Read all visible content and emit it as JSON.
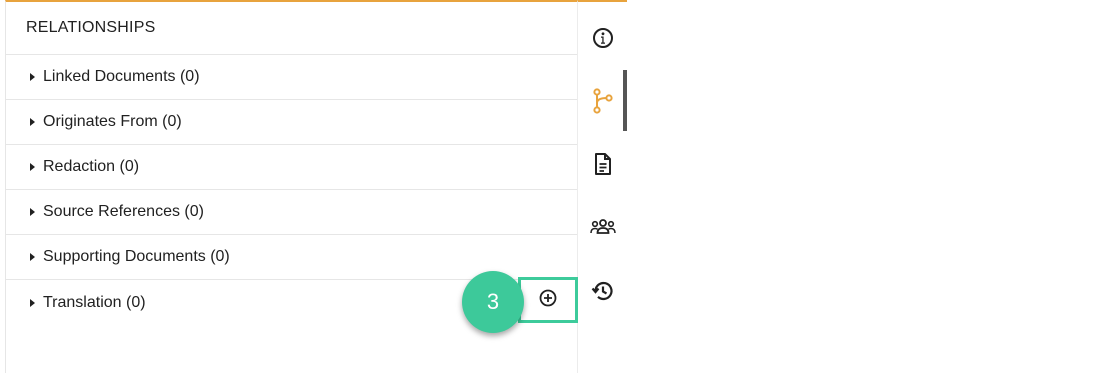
{
  "panel": {
    "title": "RELATIONSHIPS",
    "items": [
      {
        "label": "Linked Documents (0)"
      },
      {
        "label": "Originates From (0)"
      },
      {
        "label": "Redaction (0)"
      },
      {
        "label": "Source References (0)"
      },
      {
        "label": "Supporting Documents (0)"
      },
      {
        "label": "Translation (0)"
      }
    ]
  },
  "rail": {
    "icons": [
      "info-icon",
      "relationships-icon",
      "document-icon",
      "people-icon",
      "history-icon"
    ],
    "active": "relationships-icon"
  },
  "annotation": {
    "step_number": "3"
  },
  "colors": {
    "accent": "#e8a33d",
    "highlight": "#3dcb9b"
  }
}
